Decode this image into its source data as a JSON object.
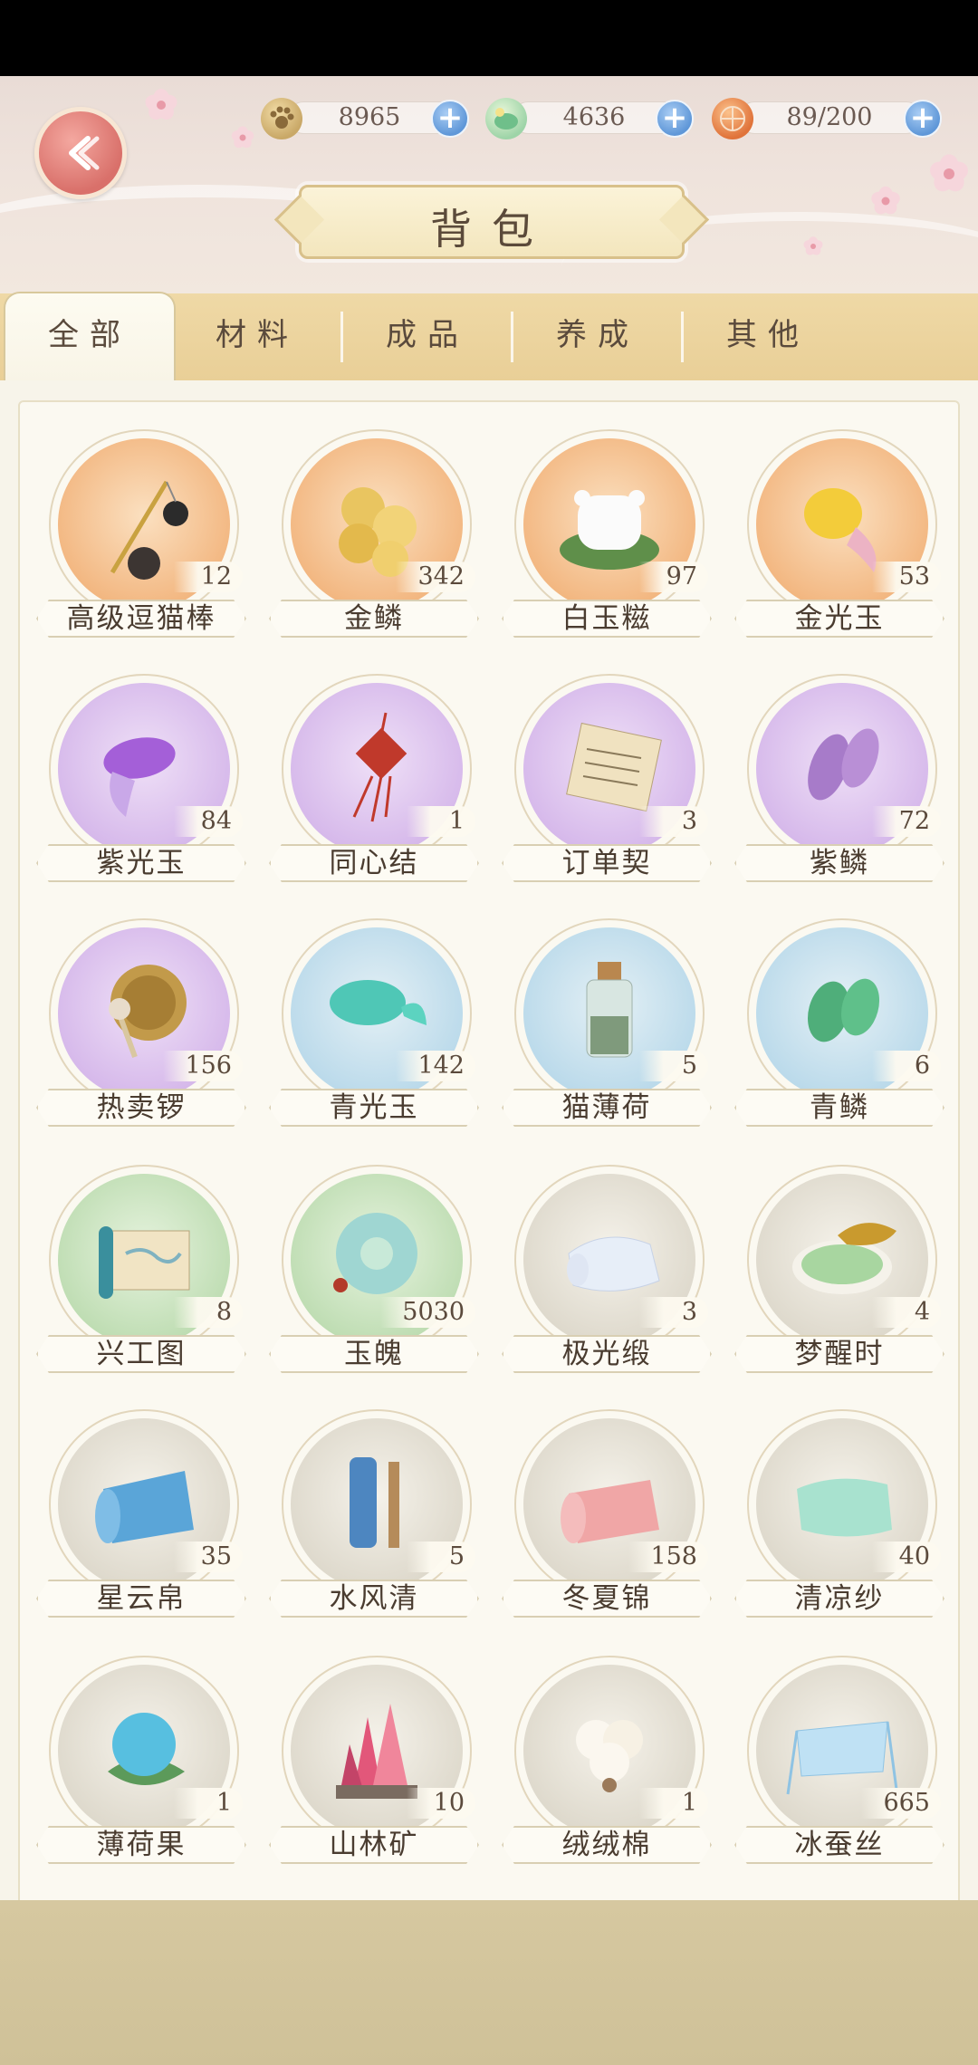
{
  "header": {
    "title": "背包",
    "back_icon": "back-arrow-icon",
    "currencies": [
      {
        "name": "cat-paw-coin",
        "icon": "paw-coin-icon",
        "value": "8965",
        "color": "#c9a867"
      },
      {
        "name": "jade-gem",
        "icon": "jade-gem-icon",
        "value": "4636",
        "color": "#9ed4a8"
      },
      {
        "name": "stamina",
        "icon": "bun-stamina-icon",
        "value": "89/200",
        "color": "#ef9a5a"
      }
    ]
  },
  "tabs": [
    {
      "label": "全部",
      "active": true
    },
    {
      "label": "材料",
      "active": false
    },
    {
      "label": "成品",
      "active": false
    },
    {
      "label": "养成",
      "active": false
    },
    {
      "label": "其他",
      "active": false
    }
  ],
  "items": [
    {
      "name": "高级逗猫棒",
      "count": "12",
      "bg": "orange",
      "icon": "cat-teaser-wand-icon"
    },
    {
      "name": "金鳞",
      "count": "342",
      "bg": "orange",
      "icon": "gold-scales-icon"
    },
    {
      "name": "白玉糍",
      "count": "97",
      "bg": "orange",
      "icon": "white-jade-mochi-icon"
    },
    {
      "name": "金光玉",
      "count": "53",
      "bg": "orange",
      "icon": "gold-fish-jade-icon"
    },
    {
      "name": "紫光玉",
      "count": "84",
      "bg": "purple",
      "icon": "purple-fish-jade-icon"
    },
    {
      "name": "同心结",
      "count": "1",
      "bg": "purple",
      "icon": "chinese-knot-icon"
    },
    {
      "name": "订单契",
      "count": "3",
      "bg": "purple",
      "icon": "order-contract-icon"
    },
    {
      "name": "紫鳞",
      "count": "72",
      "bg": "purple",
      "icon": "purple-scales-icon"
    },
    {
      "name": "热卖锣",
      "count": "156",
      "bg": "purple",
      "icon": "gong-icon"
    },
    {
      "name": "青光玉",
      "count": "142",
      "bg": "blue",
      "icon": "cyan-fish-jade-icon"
    },
    {
      "name": "猫薄荷",
      "count": "5",
      "bg": "blue",
      "icon": "catnip-bottle-icon"
    },
    {
      "name": "青鳞",
      "count": "6",
      "bg": "blue",
      "icon": "green-scales-icon"
    },
    {
      "name": "兴工图",
      "count": "8",
      "bg": "green",
      "icon": "scroll-map-icon"
    },
    {
      "name": "玉魄",
      "count": "5030",
      "bg": "green",
      "icon": "jade-ring-icon"
    },
    {
      "name": "极光缎",
      "count": "3",
      "bg": "gray",
      "icon": "aurora-satin-icon"
    },
    {
      "name": "梦醒时",
      "count": "4",
      "bg": "gray",
      "icon": "powder-bowl-icon"
    },
    {
      "name": "星云帛",
      "count": "35",
      "bg": "gray",
      "icon": "blue-silk-roll-icon"
    },
    {
      "name": "水风清",
      "count": "5",
      "bg": "gray",
      "icon": "painted-scroll-icon"
    },
    {
      "name": "冬夏锦",
      "count": "158",
      "bg": "gray",
      "icon": "pink-brocade-icon"
    },
    {
      "name": "清凉纱",
      "count": "40",
      "bg": "gray",
      "icon": "mint-gauze-icon"
    },
    {
      "name": "薄荷果",
      "count": "1",
      "bg": "gray",
      "icon": "mint-fruit-icon"
    },
    {
      "name": "山林矿",
      "count": "10",
      "bg": "gray",
      "icon": "pink-crystal-ore-icon"
    },
    {
      "name": "绒绒棉",
      "count": "1",
      "bg": "gray",
      "icon": "cotton-boll-icon"
    },
    {
      "name": "冰蚕丝",
      "count": "665",
      "bg": "gray",
      "icon": "ice-silk-icon"
    }
  ]
}
